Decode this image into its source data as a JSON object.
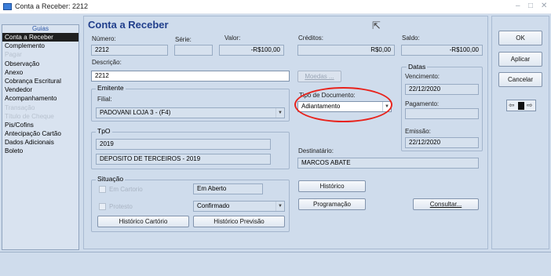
{
  "window": {
    "title": "Conta a Receber: 2212",
    "minimize": "–",
    "restore": "□",
    "close": "✕"
  },
  "sidebar": {
    "header": "Guias",
    "items": [
      {
        "label": "Conta a Receber",
        "state": "active"
      },
      {
        "label": "Complemento",
        "state": "normal"
      },
      {
        "label": "Pagar",
        "state": "disabled"
      },
      {
        "label": "Observação",
        "state": "normal"
      },
      {
        "label": "Anexo",
        "state": "normal"
      },
      {
        "label": "Cobrança Escritural",
        "state": "normal"
      },
      {
        "label": "Vendedor",
        "state": "normal"
      },
      {
        "label": "Acompanhamento",
        "state": "normal"
      },
      {
        "label": "Transação",
        "state": "disabled"
      },
      {
        "label": "Título de Cheque",
        "state": "disabled"
      },
      {
        "label": "Pis/Cofins",
        "state": "normal"
      },
      {
        "label": "Antecipação Cartão",
        "state": "normal"
      },
      {
        "label": "Dados Adicionais",
        "state": "normal"
      },
      {
        "label": "Boleto",
        "state": "normal"
      }
    ]
  },
  "form": {
    "heading": "Conta a Receber",
    "numero": {
      "label": "Número:",
      "value": "2212"
    },
    "serie": {
      "label": "Série:",
      "value": ""
    },
    "valor": {
      "label": "Valor:",
      "value": "-R$100,00"
    },
    "creditos": {
      "label": "Créditos:",
      "value": "R$0,00"
    },
    "saldo": {
      "label": "Saldo:",
      "value": "-R$100,00"
    },
    "descricao": {
      "label": "Descrição:",
      "value": "2212"
    },
    "moedas_button": "Moedas ...",
    "emitente": {
      "title": "Emitente",
      "filial_label": "Filial:",
      "filial_value": "PADOVANI LOJA 3 - (F4)"
    },
    "tpo": {
      "title": "TpO",
      "code": "2019",
      "description": "DEPOSITO DE TERCEIROS - 2019"
    },
    "tipo_documento": {
      "label": "Tipo de Documento:",
      "value": "Adiantamento"
    },
    "datas": {
      "title": "Datas",
      "vencimento_label": "Vencimento:",
      "vencimento_value": "22/12/2020",
      "pagamento_label": "Pagamento:",
      "pagamento_value": "",
      "emissao_label": "Emissão:",
      "emissao_value": "22/12/2020"
    },
    "destinatario": {
      "label": "Destinatário:",
      "value": "MARCOS ABATE"
    },
    "situacao": {
      "title": "Situação",
      "em_cartorio_label": "Em Cartorio",
      "em_cartorio_status": "Em Aberto",
      "protesto_label": "Protesto",
      "protesto_value": "Confirmado",
      "historico_cartorio_button": "Histórico Cartório",
      "historico_previsao_button": "Histórico Previsão"
    },
    "historico_button": "Histórico",
    "programacao_button": "Programação",
    "consultar_button": "Consultar..."
  },
  "actions": {
    "ok": "OK",
    "aplicar": "Aplicar",
    "cancelar": "Cancelar"
  },
  "icons": {
    "app": "app-window-icon",
    "cursor": "mouse-pointer-icon",
    "dropdown": "chevron-down-icon",
    "nav_left": "arrow-left-icon",
    "nav_right": "arrow-right-icon"
  },
  "colors": {
    "heading": "#213f8c",
    "sidebar_active": "#1f1f1f",
    "annotation": "#e8231c",
    "panel": "#cfdcec"
  }
}
